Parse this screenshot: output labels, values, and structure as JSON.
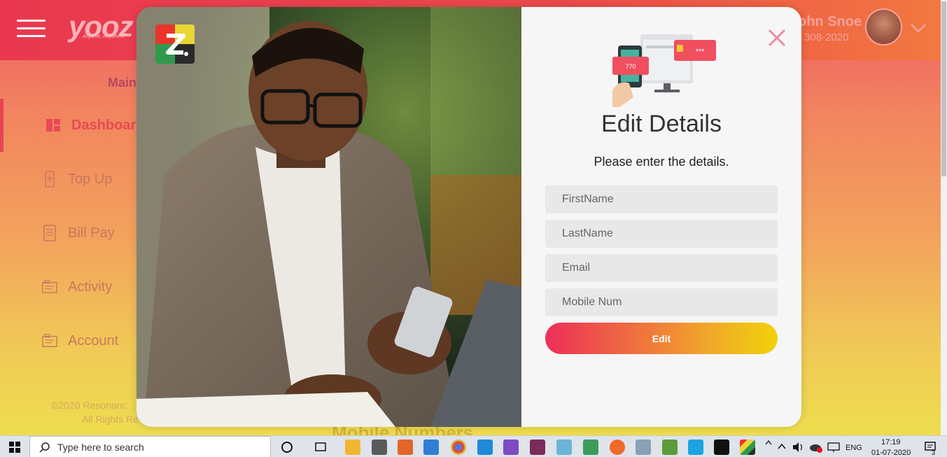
{
  "header": {
    "logo_text": "yooz",
    "logo_tagline": "Anytime, Anywhere",
    "user_name": "ohn Snoe",
    "user_phone": ") 308-2020"
  },
  "sidebar": {
    "section_label": "Main",
    "items": [
      {
        "label": "Dashboard",
        "icon": "dashboard-icon",
        "active": true
      },
      {
        "label": "Top Up",
        "icon": "mobile-topup-icon",
        "active": false
      },
      {
        "label": "Bill Pay",
        "icon": "bill-icon",
        "active": false
      },
      {
        "label": "Activity",
        "icon": "activity-icon",
        "active": false
      },
      {
        "label": "Account",
        "icon": "account-icon",
        "active": false
      }
    ],
    "copyright_line1": "©2020 Resonanc",
    "copyright_line2": "All Rights Re"
  },
  "background": {
    "heading": "Mobile Numbers"
  },
  "modal": {
    "title": "Edit Details",
    "subtitle": "Please enter the details.",
    "fields": {
      "first_name": {
        "placeholder": "FirstName",
        "value": ""
      },
      "last_name": {
        "placeholder": "LastName",
        "value": ""
      },
      "email": {
        "placeholder": "Email",
        "value": ""
      },
      "mobile": {
        "placeholder": "Mobile Num",
        "value": ""
      }
    },
    "submit_label": "Edit",
    "illustration": {
      "otp_code": "770",
      "password_mask": "***"
    }
  },
  "taskbar": {
    "search_placeholder": "Type here to search",
    "language": "ENG",
    "time": "17:19",
    "date": "01-07-2020",
    "notification_count": "3"
  },
  "colors": {
    "accent_red": "#ec2f5a",
    "accent_yellow": "#f0d20a",
    "close_pink": "#f08aa0"
  }
}
